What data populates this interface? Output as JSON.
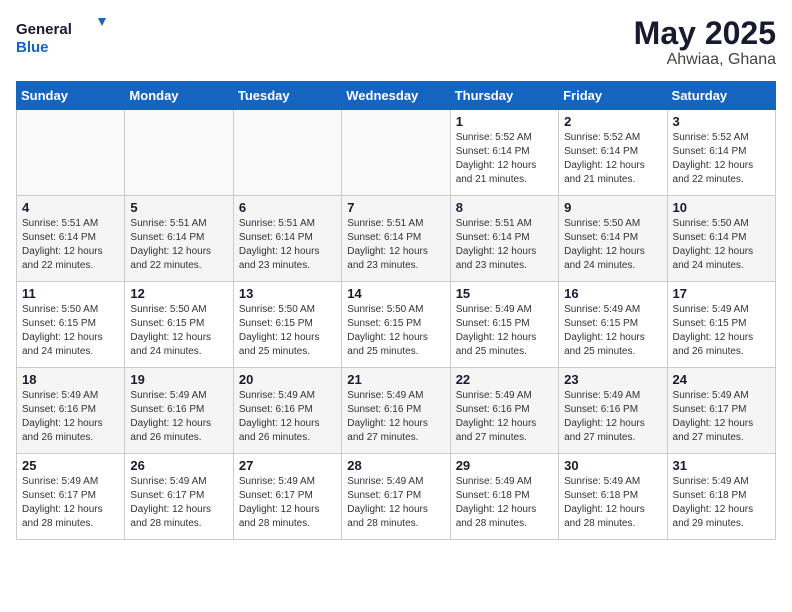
{
  "logo": {
    "line1": "General",
    "line2": "Blue"
  },
  "title": {
    "month_year": "May 2025",
    "location": "Ahwiaa, Ghana"
  },
  "days_of_week": [
    "Sunday",
    "Monday",
    "Tuesday",
    "Wednesday",
    "Thursday",
    "Friday",
    "Saturday"
  ],
  "weeks": [
    [
      {
        "day": "",
        "info": ""
      },
      {
        "day": "",
        "info": ""
      },
      {
        "day": "",
        "info": ""
      },
      {
        "day": "",
        "info": ""
      },
      {
        "day": "1",
        "info": "Sunrise: 5:52 AM\nSunset: 6:14 PM\nDaylight: 12 hours\nand 21 minutes."
      },
      {
        "day": "2",
        "info": "Sunrise: 5:52 AM\nSunset: 6:14 PM\nDaylight: 12 hours\nand 21 minutes."
      },
      {
        "day": "3",
        "info": "Sunrise: 5:52 AM\nSunset: 6:14 PM\nDaylight: 12 hours\nand 22 minutes."
      }
    ],
    [
      {
        "day": "4",
        "info": "Sunrise: 5:51 AM\nSunset: 6:14 PM\nDaylight: 12 hours\nand 22 minutes."
      },
      {
        "day": "5",
        "info": "Sunrise: 5:51 AM\nSunset: 6:14 PM\nDaylight: 12 hours\nand 22 minutes."
      },
      {
        "day": "6",
        "info": "Sunrise: 5:51 AM\nSunset: 6:14 PM\nDaylight: 12 hours\nand 23 minutes."
      },
      {
        "day": "7",
        "info": "Sunrise: 5:51 AM\nSunset: 6:14 PM\nDaylight: 12 hours\nand 23 minutes."
      },
      {
        "day": "8",
        "info": "Sunrise: 5:51 AM\nSunset: 6:14 PM\nDaylight: 12 hours\nand 23 minutes."
      },
      {
        "day": "9",
        "info": "Sunrise: 5:50 AM\nSunset: 6:14 PM\nDaylight: 12 hours\nand 24 minutes."
      },
      {
        "day": "10",
        "info": "Sunrise: 5:50 AM\nSunset: 6:14 PM\nDaylight: 12 hours\nand 24 minutes."
      }
    ],
    [
      {
        "day": "11",
        "info": "Sunrise: 5:50 AM\nSunset: 6:15 PM\nDaylight: 12 hours\nand 24 minutes."
      },
      {
        "day": "12",
        "info": "Sunrise: 5:50 AM\nSunset: 6:15 PM\nDaylight: 12 hours\nand 24 minutes."
      },
      {
        "day": "13",
        "info": "Sunrise: 5:50 AM\nSunset: 6:15 PM\nDaylight: 12 hours\nand 25 minutes."
      },
      {
        "day": "14",
        "info": "Sunrise: 5:50 AM\nSunset: 6:15 PM\nDaylight: 12 hours\nand 25 minutes."
      },
      {
        "day": "15",
        "info": "Sunrise: 5:49 AM\nSunset: 6:15 PM\nDaylight: 12 hours\nand 25 minutes."
      },
      {
        "day": "16",
        "info": "Sunrise: 5:49 AM\nSunset: 6:15 PM\nDaylight: 12 hours\nand 25 minutes."
      },
      {
        "day": "17",
        "info": "Sunrise: 5:49 AM\nSunset: 6:15 PM\nDaylight: 12 hours\nand 26 minutes."
      }
    ],
    [
      {
        "day": "18",
        "info": "Sunrise: 5:49 AM\nSunset: 6:16 PM\nDaylight: 12 hours\nand 26 minutes."
      },
      {
        "day": "19",
        "info": "Sunrise: 5:49 AM\nSunset: 6:16 PM\nDaylight: 12 hours\nand 26 minutes."
      },
      {
        "day": "20",
        "info": "Sunrise: 5:49 AM\nSunset: 6:16 PM\nDaylight: 12 hours\nand 26 minutes."
      },
      {
        "day": "21",
        "info": "Sunrise: 5:49 AM\nSunset: 6:16 PM\nDaylight: 12 hours\nand 27 minutes."
      },
      {
        "day": "22",
        "info": "Sunrise: 5:49 AM\nSunset: 6:16 PM\nDaylight: 12 hours\nand 27 minutes."
      },
      {
        "day": "23",
        "info": "Sunrise: 5:49 AM\nSunset: 6:16 PM\nDaylight: 12 hours\nand 27 minutes."
      },
      {
        "day": "24",
        "info": "Sunrise: 5:49 AM\nSunset: 6:17 PM\nDaylight: 12 hours\nand 27 minutes."
      }
    ],
    [
      {
        "day": "25",
        "info": "Sunrise: 5:49 AM\nSunset: 6:17 PM\nDaylight: 12 hours\nand 28 minutes."
      },
      {
        "day": "26",
        "info": "Sunrise: 5:49 AM\nSunset: 6:17 PM\nDaylight: 12 hours\nand 28 minutes."
      },
      {
        "day": "27",
        "info": "Sunrise: 5:49 AM\nSunset: 6:17 PM\nDaylight: 12 hours\nand 28 minutes."
      },
      {
        "day": "28",
        "info": "Sunrise: 5:49 AM\nSunset: 6:17 PM\nDaylight: 12 hours\nand 28 minutes."
      },
      {
        "day": "29",
        "info": "Sunrise: 5:49 AM\nSunset: 6:18 PM\nDaylight: 12 hours\nand 28 minutes."
      },
      {
        "day": "30",
        "info": "Sunrise: 5:49 AM\nSunset: 6:18 PM\nDaylight: 12 hours\nand 28 minutes."
      },
      {
        "day": "31",
        "info": "Sunrise: 5:49 AM\nSunset: 6:18 PM\nDaylight: 12 hours\nand 29 minutes."
      }
    ]
  ]
}
